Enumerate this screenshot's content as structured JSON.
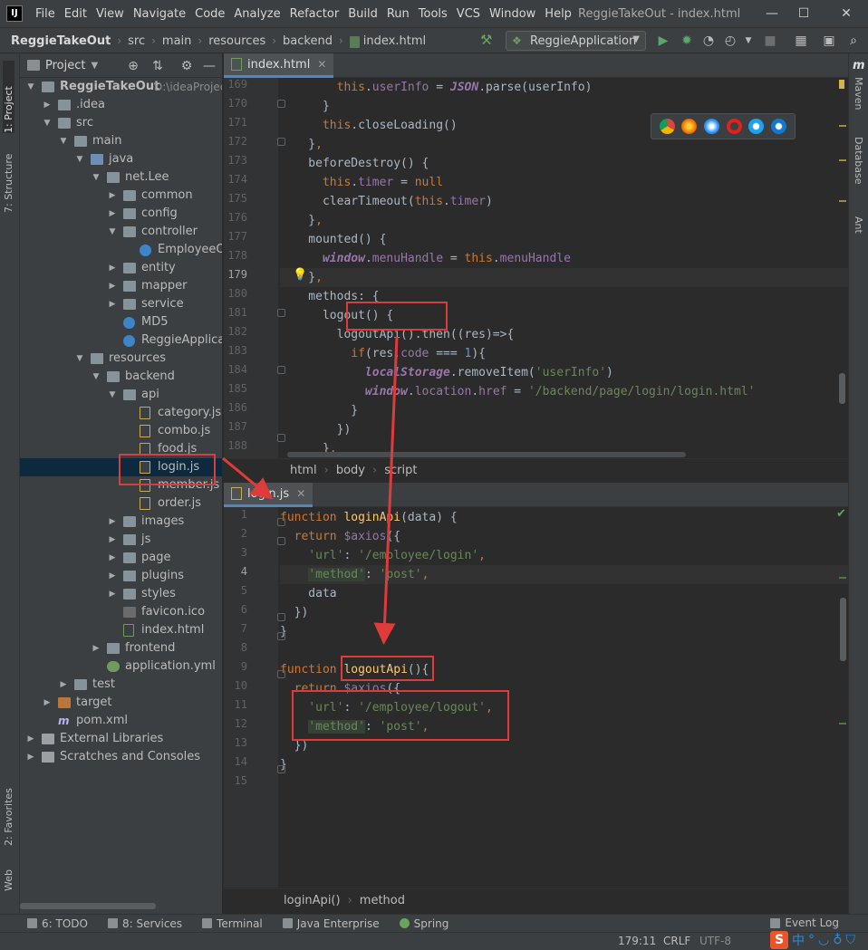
{
  "app": {
    "logo_text": "IJ",
    "window_title": "ReggieTakeOut - index.html",
    "menu": [
      "File",
      "Edit",
      "View",
      "Navigate",
      "Code",
      "Analyze",
      "Refactor",
      "Build",
      "Run",
      "Tools",
      "VCS",
      "Window",
      "Help"
    ],
    "window_controls": {
      "minimize": "—",
      "maximize": "☐",
      "close": "✕"
    }
  },
  "navbar": {
    "crumbs": [
      "ReggieTakeOut",
      "src",
      "main",
      "resources",
      "backend",
      "index.html"
    ],
    "run_config": "ReggieApplication"
  },
  "left_strip": {
    "project": "1: Project",
    "structure": "7: Structure",
    "favorites": "2: Favorites",
    "web": "Web"
  },
  "right_strip": {
    "maven": "Maven",
    "database": "Database",
    "ant": "Ant",
    "maven_logo": "m"
  },
  "project_panel": {
    "title": "Project",
    "tree": [
      {
        "label": "ReggieTakeOut",
        "extra": "D:\\ideaProjects",
        "icon": "folder",
        "indent": 0,
        "expanded": true,
        "bold": true
      },
      {
        "label": ".idea",
        "icon": "folder",
        "indent": 1,
        "expanded": false
      },
      {
        "label": "src",
        "icon": "folder",
        "indent": 1,
        "expanded": true
      },
      {
        "label": "main",
        "icon": "folder",
        "indent": 2,
        "expanded": true
      },
      {
        "label": "java",
        "icon": "folder-blue",
        "indent": 3,
        "expanded": true
      },
      {
        "label": "net.Lee",
        "icon": "folder",
        "indent": 4,
        "expanded": true
      },
      {
        "label": "common",
        "icon": "folder",
        "indent": 5,
        "expanded": false
      },
      {
        "label": "config",
        "icon": "folder",
        "indent": 5,
        "expanded": false
      },
      {
        "label": "controller",
        "icon": "folder",
        "indent": 5,
        "expanded": true
      },
      {
        "label": "EmployeeController",
        "icon": "class",
        "indent": 6,
        "expanded": null
      },
      {
        "label": "entity",
        "icon": "folder",
        "indent": 5,
        "expanded": false
      },
      {
        "label": "mapper",
        "icon": "folder",
        "indent": 5,
        "expanded": false
      },
      {
        "label": "service",
        "icon": "folder",
        "indent": 5,
        "expanded": false
      },
      {
        "label": "MD5",
        "icon": "class",
        "indent": 5,
        "expanded": null
      },
      {
        "label": "ReggieApplication",
        "icon": "class",
        "indent": 5,
        "expanded": null
      },
      {
        "label": "resources",
        "icon": "folder",
        "indent": 3,
        "expanded": true
      },
      {
        "label": "backend",
        "icon": "folder",
        "indent": 4,
        "expanded": true
      },
      {
        "label": "api",
        "icon": "folder",
        "indent": 5,
        "expanded": true
      },
      {
        "label": "category.js",
        "icon": "js",
        "indent": 6,
        "expanded": null
      },
      {
        "label": "combo.js",
        "icon": "js",
        "indent": 6,
        "expanded": null
      },
      {
        "label": "food.js",
        "icon": "js",
        "indent": 6,
        "expanded": null
      },
      {
        "label": "login.js",
        "icon": "js",
        "indent": 6,
        "expanded": null,
        "selected": true
      },
      {
        "label": "member.js",
        "icon": "js",
        "indent": 6,
        "expanded": null
      },
      {
        "label": "order.js",
        "icon": "js",
        "indent": 6,
        "expanded": null
      },
      {
        "label": "images",
        "icon": "folder",
        "indent": 5,
        "expanded": false
      },
      {
        "label": "js",
        "icon": "folder",
        "indent": 5,
        "expanded": false
      },
      {
        "label": "page",
        "icon": "folder",
        "indent": 5,
        "expanded": false
      },
      {
        "label": "plugins",
        "icon": "folder",
        "indent": 5,
        "expanded": false
      },
      {
        "label": "styles",
        "icon": "folder",
        "indent": 5,
        "expanded": false
      },
      {
        "label": "favicon.ico",
        "icon": "ico",
        "indent": 5,
        "expanded": null
      },
      {
        "label": "index.html",
        "icon": "html",
        "indent": 5,
        "expanded": null
      },
      {
        "label": "frontend",
        "icon": "folder",
        "indent": 4,
        "expanded": false
      },
      {
        "label": "application.yml",
        "icon": "yml",
        "indent": 4,
        "expanded": null
      },
      {
        "label": "test",
        "icon": "folder",
        "indent": 2,
        "expanded": false
      },
      {
        "label": "target",
        "icon": "folder-orange",
        "indent": 1,
        "expanded": false
      },
      {
        "label": "pom.xml",
        "icon": "mvn",
        "indent": 1,
        "expanded": null
      },
      {
        "label": "External Libraries",
        "icon": "lib",
        "indent": 0,
        "expanded": false
      },
      {
        "label": "Scratches and Consoles",
        "icon": "lib",
        "indent": 0,
        "expanded": false
      }
    ]
  },
  "editor_top": {
    "tab": "index.html",
    "current_line": 179,
    "lines": [
      {
        "n": 169,
        "tokens": [
          [
            "        ",
            ""
          ],
          [
            "this",
            "kw"
          ],
          [
            ".",
            ""
          ],
          [
            "userInfo",
            "prop"
          ],
          [
            " = ",
            ""
          ],
          [
            "JSON",
            "glob"
          ],
          [
            ".parse(userInfo)",
            ""
          ]
        ]
      },
      {
        "n": 170,
        "tokens": [
          [
            "      }",
            ""
          ]
        ]
      },
      {
        "n": 171,
        "tokens": [
          [
            "      ",
            ""
          ],
          [
            "this",
            "kw"
          ],
          [
            ".closeLoading()",
            ""
          ]
        ]
      },
      {
        "n": 172,
        "tokens": [
          [
            "    }",
            ""
          ],
          [
            ",",
            "kw"
          ]
        ]
      },
      {
        "n": 173,
        "tokens": [
          [
            "    beforeDestroy() {",
            ""
          ]
        ]
      },
      {
        "n": 174,
        "tokens": [
          [
            "      ",
            ""
          ],
          [
            "this",
            "kw"
          ],
          [
            ".",
            ""
          ],
          [
            "timer",
            "prop"
          ],
          [
            " = ",
            ""
          ],
          [
            "null",
            "kw"
          ]
        ]
      },
      {
        "n": 175,
        "tokens": [
          [
            "      clearTimeout(",
            ""
          ],
          [
            "this",
            "kw"
          ],
          [
            ".",
            ""
          ],
          [
            "timer",
            "prop"
          ],
          [
            ")",
            ""
          ]
        ]
      },
      {
        "n": 176,
        "tokens": [
          [
            "    }",
            ""
          ],
          [
            ",",
            "kw"
          ]
        ]
      },
      {
        "n": 177,
        "tokens": [
          [
            "    mounted() {",
            ""
          ]
        ]
      },
      {
        "n": 178,
        "tokens": [
          [
            "      ",
            ""
          ],
          [
            "window",
            "glob"
          ],
          [
            ".",
            ""
          ],
          [
            "menuHandle",
            "prop"
          ],
          [
            " = ",
            ""
          ],
          [
            "this",
            "kw"
          ],
          [
            ".",
            ""
          ],
          [
            "menuHandle",
            "prop"
          ]
        ]
      },
      {
        "n": 179,
        "tokens": [
          [
            "    }",
            ""
          ],
          [
            ",",
            "kw"
          ]
        ]
      },
      {
        "n": 180,
        "tokens": [
          [
            "    methods: {",
            ""
          ]
        ]
      },
      {
        "n": 181,
        "tokens": [
          [
            "      logout() {",
            ""
          ]
        ]
      },
      {
        "n": 182,
        "tokens": [
          [
            "        logoutApi().then((res)=>{",
            ""
          ]
        ]
      },
      {
        "n": 183,
        "tokens": [
          [
            "          ",
            ""
          ],
          [
            "if",
            "kw"
          ],
          [
            "(res.",
            ""
          ],
          [
            "code",
            "prop"
          ],
          [
            " === ",
            ""
          ],
          [
            "1",
            "num"
          ],
          [
            "){",
            ""
          ]
        ]
      },
      {
        "n": 184,
        "tokens": [
          [
            "            ",
            ""
          ],
          [
            "localStorage",
            "glob"
          ],
          [
            ".removeItem(",
            ""
          ],
          [
            "'userInfo'",
            "str"
          ],
          [
            ")",
            ""
          ]
        ]
      },
      {
        "n": 185,
        "tokens": [
          [
            "            ",
            ""
          ],
          [
            "window",
            "glob"
          ],
          [
            ".",
            ""
          ],
          [
            "location",
            "prop"
          ],
          [
            ".",
            ""
          ],
          [
            "href",
            "prop"
          ],
          [
            " = ",
            ""
          ],
          [
            "'/backend/page/login/login.html'",
            "str"
          ]
        ]
      },
      {
        "n": 186,
        "tokens": [
          [
            "          }",
            ""
          ]
        ]
      },
      {
        "n": 187,
        "tokens": [
          [
            "        })",
            ""
          ]
        ]
      },
      {
        "n": 188,
        "tokens": [
          [
            "      }",
            ""
          ],
          [
            ",",
            "kw"
          ]
        ]
      }
    ],
    "breadcrumb": [
      "html",
      "body",
      "script"
    ]
  },
  "editor_bottom": {
    "tab": "login.js",
    "current_line": 4,
    "lines": [
      {
        "n": 1,
        "tokens": [
          [
            "function",
            "kw"
          ],
          [
            " ",
            ""
          ],
          [
            "loginApi",
            "fn"
          ],
          [
            "(data) {",
            ""
          ]
        ]
      },
      {
        "n": 2,
        "tokens": [
          [
            "  ",
            ""
          ],
          [
            "return",
            "kw"
          ],
          [
            " ",
            ""
          ],
          [
            "$axios",
            "prop"
          ],
          [
            "({",
            ""
          ]
        ]
      },
      {
        "n": 3,
        "tokens": [
          [
            "    ",
            ""
          ],
          [
            "'url'",
            "str"
          ],
          [
            ": ",
            ""
          ],
          [
            "'/employee/login'",
            "str"
          ],
          [
            ",",
            "kw"
          ]
        ]
      },
      {
        "n": 4,
        "tokens": [
          [
            "    ",
            ""
          ],
          [
            "'method'",
            "str hl-bg"
          ],
          [
            ": ",
            ""
          ],
          [
            "'post'",
            "str"
          ],
          [
            ",",
            "kw"
          ]
        ]
      },
      {
        "n": 5,
        "tokens": [
          [
            "    data",
            ""
          ]
        ]
      },
      {
        "n": 6,
        "tokens": [
          [
            "  })",
            ""
          ]
        ]
      },
      {
        "n": 7,
        "tokens": [
          [
            "}",
            ""
          ]
        ]
      },
      {
        "n": 8,
        "tokens": [
          [
            "",
            ""
          ]
        ]
      },
      {
        "n": 9,
        "tokens": [
          [
            "function",
            "kw"
          ],
          [
            " ",
            ""
          ],
          [
            "logoutApi",
            "fn"
          ],
          [
            "(){",
            ""
          ]
        ]
      },
      {
        "n": 10,
        "tokens": [
          [
            "  ",
            ""
          ],
          [
            "return",
            "kw"
          ],
          [
            " ",
            ""
          ],
          [
            "$axios",
            "prop"
          ],
          [
            "({",
            ""
          ]
        ]
      },
      {
        "n": 11,
        "tokens": [
          [
            "    ",
            ""
          ],
          [
            "'url'",
            "str"
          ],
          [
            ": ",
            ""
          ],
          [
            "'/employee/logout'",
            "str"
          ],
          [
            ",",
            "kw"
          ]
        ]
      },
      {
        "n": 12,
        "tokens": [
          [
            "    ",
            ""
          ],
          [
            "'method'",
            "str hl-bg"
          ],
          [
            ": ",
            ""
          ],
          [
            "'post'",
            "str"
          ],
          [
            ",",
            "kw"
          ]
        ]
      },
      {
        "n": 13,
        "tokens": [
          [
            "  })",
            ""
          ]
        ]
      },
      {
        "n": 14,
        "tokens": [
          [
            "}",
            ""
          ]
        ]
      },
      {
        "n": 15,
        "tokens": [
          [
            "",
            ""
          ]
        ]
      }
    ],
    "breadcrumb": [
      "loginApi()",
      "method"
    ]
  },
  "browsers": [
    "chrome",
    "firefox",
    "safari",
    "opera",
    "ie",
    "edge"
  ],
  "bottom_bar": {
    "todo": "6: TODO",
    "services": "8: Services",
    "terminal": "Terminal",
    "java_enterprise": "Java Enterprise",
    "spring": "Spring",
    "event_log": "Event Log"
  },
  "status_bar": {
    "position": "179:11",
    "line_sep": "CRLF",
    "encoding": "UTF-8"
  },
  "ime": {
    "logo": "S",
    "glyphs": [
      "中",
      "°",
      "◡",
      "♁",
      "⛉"
    ]
  },
  "colors": {
    "annotation_red": "#e03b3b",
    "accent": "#4a88c7"
  }
}
